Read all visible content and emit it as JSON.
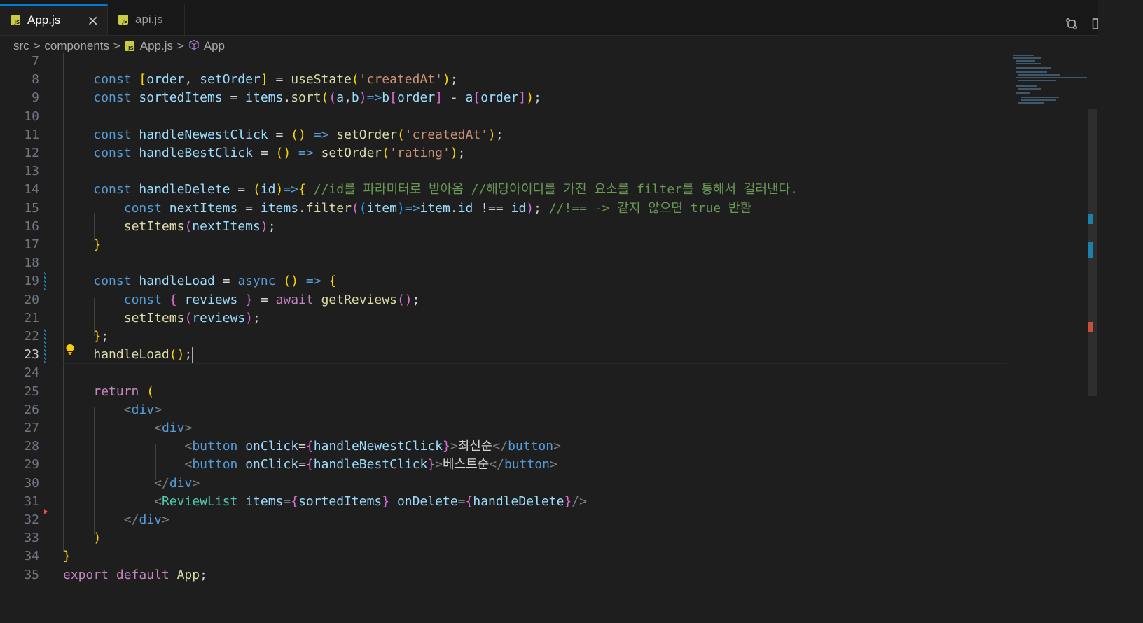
{
  "tabs": [
    {
      "label": "App.js",
      "icon": "js-icon",
      "close": "×"
    },
    {
      "label": "api.js",
      "icon": "js-icon"
    }
  ],
  "js_badge": "JS",
  "breadcrumb": {
    "items": [
      "src",
      "components",
      "App.js",
      "App"
    ],
    "separator": ">"
  },
  "editor": {
    "current_line": 23,
    "line_numbers": [
      "7",
      "8",
      "9",
      "10",
      "11",
      "12",
      "13",
      "14",
      "15",
      "16",
      "17",
      "18",
      "19",
      "20",
      "21",
      "22",
      "23",
      "24",
      "25",
      "26",
      "27",
      "28",
      "29",
      "30",
      "31",
      "32",
      "33",
      "34",
      "35"
    ],
    "code_lines": [
      "",
      "    const [order, setOrder] = useState('createdAt');",
      "    const sortedItems = items.sort((a,b)=>b[order] - a[order]);",
      "",
      "    const handleNewestClick = () => setOrder('createdAt');",
      "    const handleBestClick = () => setOrder('rating');",
      "",
      "    const handleDelete = (id)=>{ //id를 파라미터로 받아옴 //해당아이디를 가진 요소를 filter를 통해서 걸러낸다.",
      "        const nextItems = items.filter((item)=>item.id !== id); //!== -> 같지 않으면 true 반환",
      "        setItems(nextItems);",
      "    }",
      "",
      "    const handleLoad = async () => {",
      "        const { reviews } = await getReviews();",
      "        setItems(reviews);",
      "    };",
      "    handleLoad();",
      "",
      "    return (",
      "        <div>",
      "            <div>",
      "                <button onClick={handleNewestClick}>최신순</button>",
      "                <button onClick={handleBestClick}>베스트순</button>",
      "            </div>",
      "            <ReviewList items={sortedItems} onDelete={handleDelete}/>",
      "        </div>",
      "    )",
      "}",
      "export default App;"
    ]
  },
  "colors": {
    "background": "#1e1e1e",
    "keyword": "#569cd6",
    "variable": "#9cdcfe",
    "function": "#dcdcaa",
    "string": "#ce9178",
    "comment": "#6a9955",
    "control": "#c586c0",
    "component": "#4ec9b0"
  },
  "icons": [
    "js-icon",
    "compare-changes-icon",
    "split-editor-icon",
    "more-actions-icon",
    "symbol-class-icon",
    "lightbulb-icon"
  ]
}
